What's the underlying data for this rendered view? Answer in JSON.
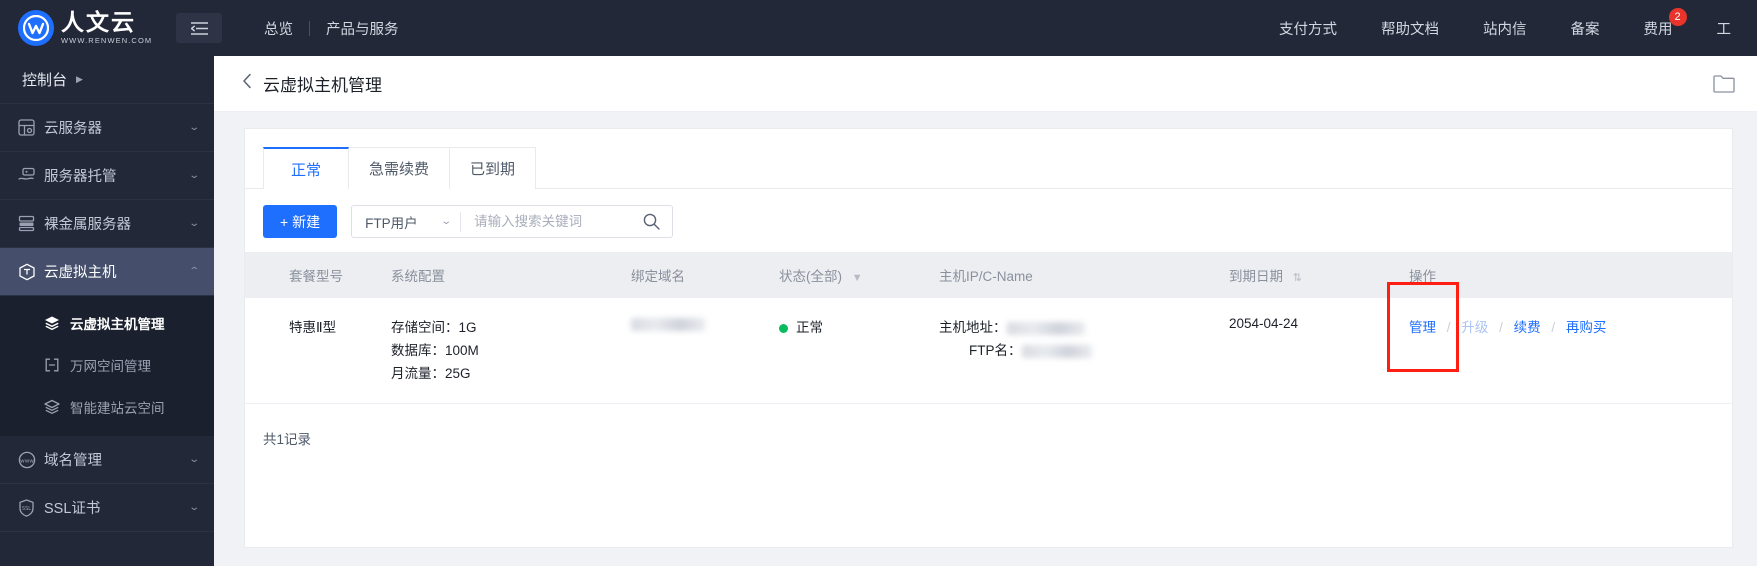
{
  "header": {
    "logo_cn": "人文云",
    "logo_url": "WWW.RENWEN.COM",
    "collapse_icon": "collapse-menu-icon",
    "nav_left": [
      {
        "label": "总览"
      },
      {
        "label": "产品与服务"
      }
    ],
    "nav_right": [
      {
        "label": "支付方式",
        "badge": ""
      },
      {
        "label": "帮助文档",
        "badge": ""
      },
      {
        "label": "站内信",
        "badge": ""
      },
      {
        "label": "备案",
        "badge": ""
      },
      {
        "label": "费用",
        "badge": "2"
      },
      {
        "label": "工",
        "badge": ""
      }
    ],
    "badge_color": "#e8342b"
  },
  "sidebar": {
    "console_label": "控制台",
    "console_arrow": "▶",
    "items": [
      {
        "label": "云服务器",
        "icon": "server-icon",
        "chevron": "⌄",
        "active": false
      },
      {
        "label": "服务器托管",
        "icon": "hosting-hand-icon",
        "chevron": "⌄",
        "active": false
      },
      {
        "label": "裸金属服务器",
        "icon": "rack-icon",
        "chevron": "⌄",
        "active": false
      },
      {
        "label": "云虚拟主机",
        "icon": "cube-icon",
        "chevron": "⌃",
        "active": true
      },
      {
        "label": "域名管理",
        "icon": "www-icon",
        "chevron": "⌄",
        "active": false
      },
      {
        "label": "SSL证书",
        "icon": "ssl-shield-icon",
        "chevron": "⌄",
        "active": false
      }
    ],
    "submenu": [
      {
        "label": "云虚拟主机管理",
        "icon": "layers-icon",
        "active": true
      },
      {
        "label": "万网空间管理",
        "icon": "bracket-icon",
        "active": false
      },
      {
        "label": "智能建站云空间",
        "icon": "layers-icon",
        "active": false
      }
    ]
  },
  "page": {
    "back_icon": "chevron-left-icon",
    "title": "云虚拟主机管理",
    "head_right_icon": "folder-icon"
  },
  "tabs": [
    {
      "label": "正常",
      "active": true
    },
    {
      "label": "急需续费",
      "active": false
    },
    {
      "label": "已到期",
      "active": false
    }
  ],
  "toolbar": {
    "new_button": "+ 新建",
    "filter_select": "FTP用户",
    "select_chevron": "⌄",
    "search_placeholder": "请输入搜索关键词",
    "search_value": "",
    "search_icon": "search-icon"
  },
  "table": {
    "columns": [
      {
        "label": "套餐型号",
        "icon": ""
      },
      {
        "label": "系统配置",
        "icon": ""
      },
      {
        "label": "绑定域名",
        "icon": ""
      },
      {
        "label": "状态(全部)",
        "icon": "filter-icon"
      },
      {
        "label": "主机IP/C-Name",
        "icon": ""
      },
      {
        "label": "到期日期",
        "icon": "sort-icon"
      },
      {
        "label": "操作",
        "icon": ""
      }
    ],
    "rows": [
      {
        "plan": "特惠Ⅱ型",
        "config": [
          "存储空间：1G",
          "数据库：100M",
          "月流量：25G"
        ],
        "domain_masked": true,
        "status": "正常",
        "status_color": "#09bb5f",
        "host_labels": [
          "主机地址：",
          "FTP名："
        ],
        "expiry": "2054-04-24",
        "actions": [
          {
            "label": "管理",
            "disabled": false,
            "highlighted": true
          },
          {
            "label": "升级",
            "disabled": true,
            "highlighted": false
          },
          {
            "label": "续费",
            "disabled": false,
            "highlighted": false
          },
          {
            "label": "再购买",
            "disabled": false,
            "highlighted": false
          }
        ],
        "action_sep": "/"
      }
    ],
    "footer_count": "共1记录"
  },
  "colors": {
    "accent": "#1f6fff",
    "sidebar_bg": "#232838",
    "highlight_box": "#ff1f12"
  }
}
